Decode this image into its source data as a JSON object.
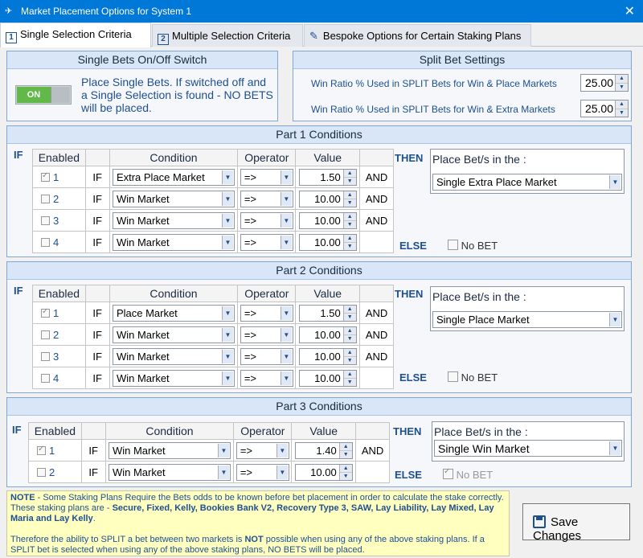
{
  "window": {
    "title": "Market Placement Options for System 1",
    "close": "✕"
  },
  "tabs": [
    {
      "num": "1",
      "label": "Single Selection Criteria"
    },
    {
      "num": "2",
      "label": "Multiple Selection Criteria"
    },
    {
      "label": "Bespoke Options for Certain Staking Plans"
    }
  ],
  "single_bets": {
    "header": "Single Bets On/Off Switch",
    "toggle": "ON",
    "description": "Place Single Bets. If switched off and a Single Selection is found - NO BETS will be placed."
  },
  "split": {
    "header": "Split Bet Settings",
    "row1_label": "Win Ratio % Used in SPLIT Bets for Win & Place Markets",
    "row1_value": "25.00",
    "row2_label": "Win Ratio % Used in SPLIT Bets for Win & Extra Markets",
    "row2_value": "25.00"
  },
  "columns": {
    "enabled": "Enabled",
    "condition": "Condition",
    "operator": "Operator",
    "value": "Value"
  },
  "words": {
    "if": "IF",
    "then": "THEN",
    "else": "ELSE",
    "and": "AND",
    "place_in": "Place Bet/s in the :",
    "no_bet": "No BET"
  },
  "part1": {
    "header": "Part 1 Conditions",
    "rows": [
      {
        "n": "1",
        "condition": "Extra Place Market",
        "operator": "=>",
        "value": "1.50",
        "and": "AND"
      },
      {
        "n": "2",
        "condition": "Win Market",
        "operator": "=>",
        "value": "10.00",
        "and": "AND"
      },
      {
        "n": "3",
        "condition": "Win Market",
        "operator": "=>",
        "value": "10.00",
        "and": "AND"
      },
      {
        "n": "4",
        "condition": "Win Market",
        "operator": "=>",
        "value": "10.00",
        "and": ""
      }
    ],
    "then_value": "Single Extra Place Market"
  },
  "part2": {
    "header": "Part 2 Conditions",
    "rows": [
      {
        "n": "1",
        "condition": "Place Market",
        "operator": "=>",
        "value": "1.50",
        "and": "AND"
      },
      {
        "n": "2",
        "condition": "Win Market",
        "operator": "=>",
        "value": "10.00",
        "and": "AND"
      },
      {
        "n": "3",
        "condition": "Win Market",
        "operator": "=>",
        "value": "10.00",
        "and": "AND"
      },
      {
        "n": "4",
        "condition": "Win Market",
        "operator": "=>",
        "value": "10.00",
        "and": ""
      }
    ],
    "then_value": "Single Place Market"
  },
  "part3": {
    "header": "Part 3 Conditions",
    "rows": [
      {
        "n": "1",
        "condition": "Win Market",
        "operator": "=>",
        "value": "1.40",
        "and": "AND"
      },
      {
        "n": "2",
        "condition": "Win Market",
        "operator": "=>",
        "value": "10.00",
        "and": ""
      }
    ],
    "then_value": "Single Win Market"
  },
  "note": {
    "prefix": "NOTE",
    "text1": " - Some Staking Plans Require the Bets odds to be known before bet placement in order to calculate the stake correctly. These staking plans are - ",
    "plans": "Secure, Fixed, Kelly, Bookies Bank V2, Recovery Type 3, SAW, Lay Liability, Lay Mixed, Lay Maria and Lay Kelly",
    "text2": ".",
    "para2a": "Therefore the ability to SPLIT a bet between two markets is ",
    "para2_bold": "NOT",
    "para2b": " possible when using any of the above staking plans. If a SPLIT bet is selected when using any of the above staking plans, NO BETS will be placed."
  },
  "save_label": "Save Changes"
}
